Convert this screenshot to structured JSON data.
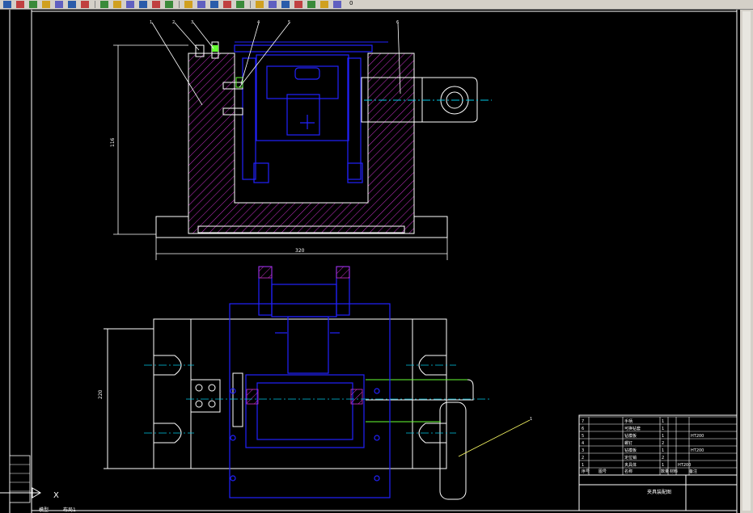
{
  "toolbar": {
    "icons": [
      "new-icon",
      "open-icon",
      "save-icon",
      "print-icon",
      "preview-icon",
      "publish-icon",
      "plot-icon",
      "cut-icon",
      "copy-icon",
      "paste-icon",
      "match-icon",
      "undo-icon",
      "redo-icon",
      "pan-icon",
      "zoom-realtime-icon",
      "zoom-window-icon",
      "zoom-previous-icon",
      "properties-icon",
      "design-center-icon",
      "tool-palette-icon",
      "calculator-icon",
      "layer-icon",
      "layer-state-icon",
      "layer-light-icon",
      "layer-color-icon"
    ],
    "layer_value": "0"
  },
  "colors": {
    "background": "#000000",
    "hatch": "#cc33cc",
    "outline": "#ffffff",
    "blue": "#2222ff",
    "cyan": "#00c8e6",
    "yellow": "#ffff66",
    "green": "#66ff33"
  },
  "drawing": {
    "balloons": [
      "1",
      "2",
      "3",
      "4",
      "5",
      "6"
    ],
    "dim_height": "116",
    "dim_width": "320",
    "dim_plan": "220"
  },
  "title_block": {
    "parts_rows": [
      {
        "no": "7",
        "name": "手柄",
        "qty": "1",
        "material": "",
        "note": ""
      },
      {
        "no": "6",
        "name": "可换钻套",
        "qty": "1",
        "material": "",
        "note": ""
      },
      {
        "no": "5",
        "name": "钻模板",
        "qty": "1",
        "material": "",
        "note": "HT200"
      },
      {
        "no": "4",
        "name": "螺钉",
        "qty": "2",
        "material": "",
        "note": ""
      },
      {
        "no": "3",
        "name": "钻模板",
        "qty": "1",
        "material": "",
        "note": "HT200"
      },
      {
        "no": "2",
        "name": "定位销",
        "qty": "2",
        "material": "",
        "note": ""
      },
      {
        "no": "1",
        "name": "夹具体",
        "qty": "1",
        "material": "HT200",
        "note": ""
      }
    ],
    "header": [
      "序号",
      "图号",
      "名称",
      "数量",
      "材料",
      "备注"
    ],
    "drawing_name": "夹具装配图"
  },
  "ucs": {
    "label": "X"
  },
  "tabs": [
    "模型",
    "布局1"
  ]
}
